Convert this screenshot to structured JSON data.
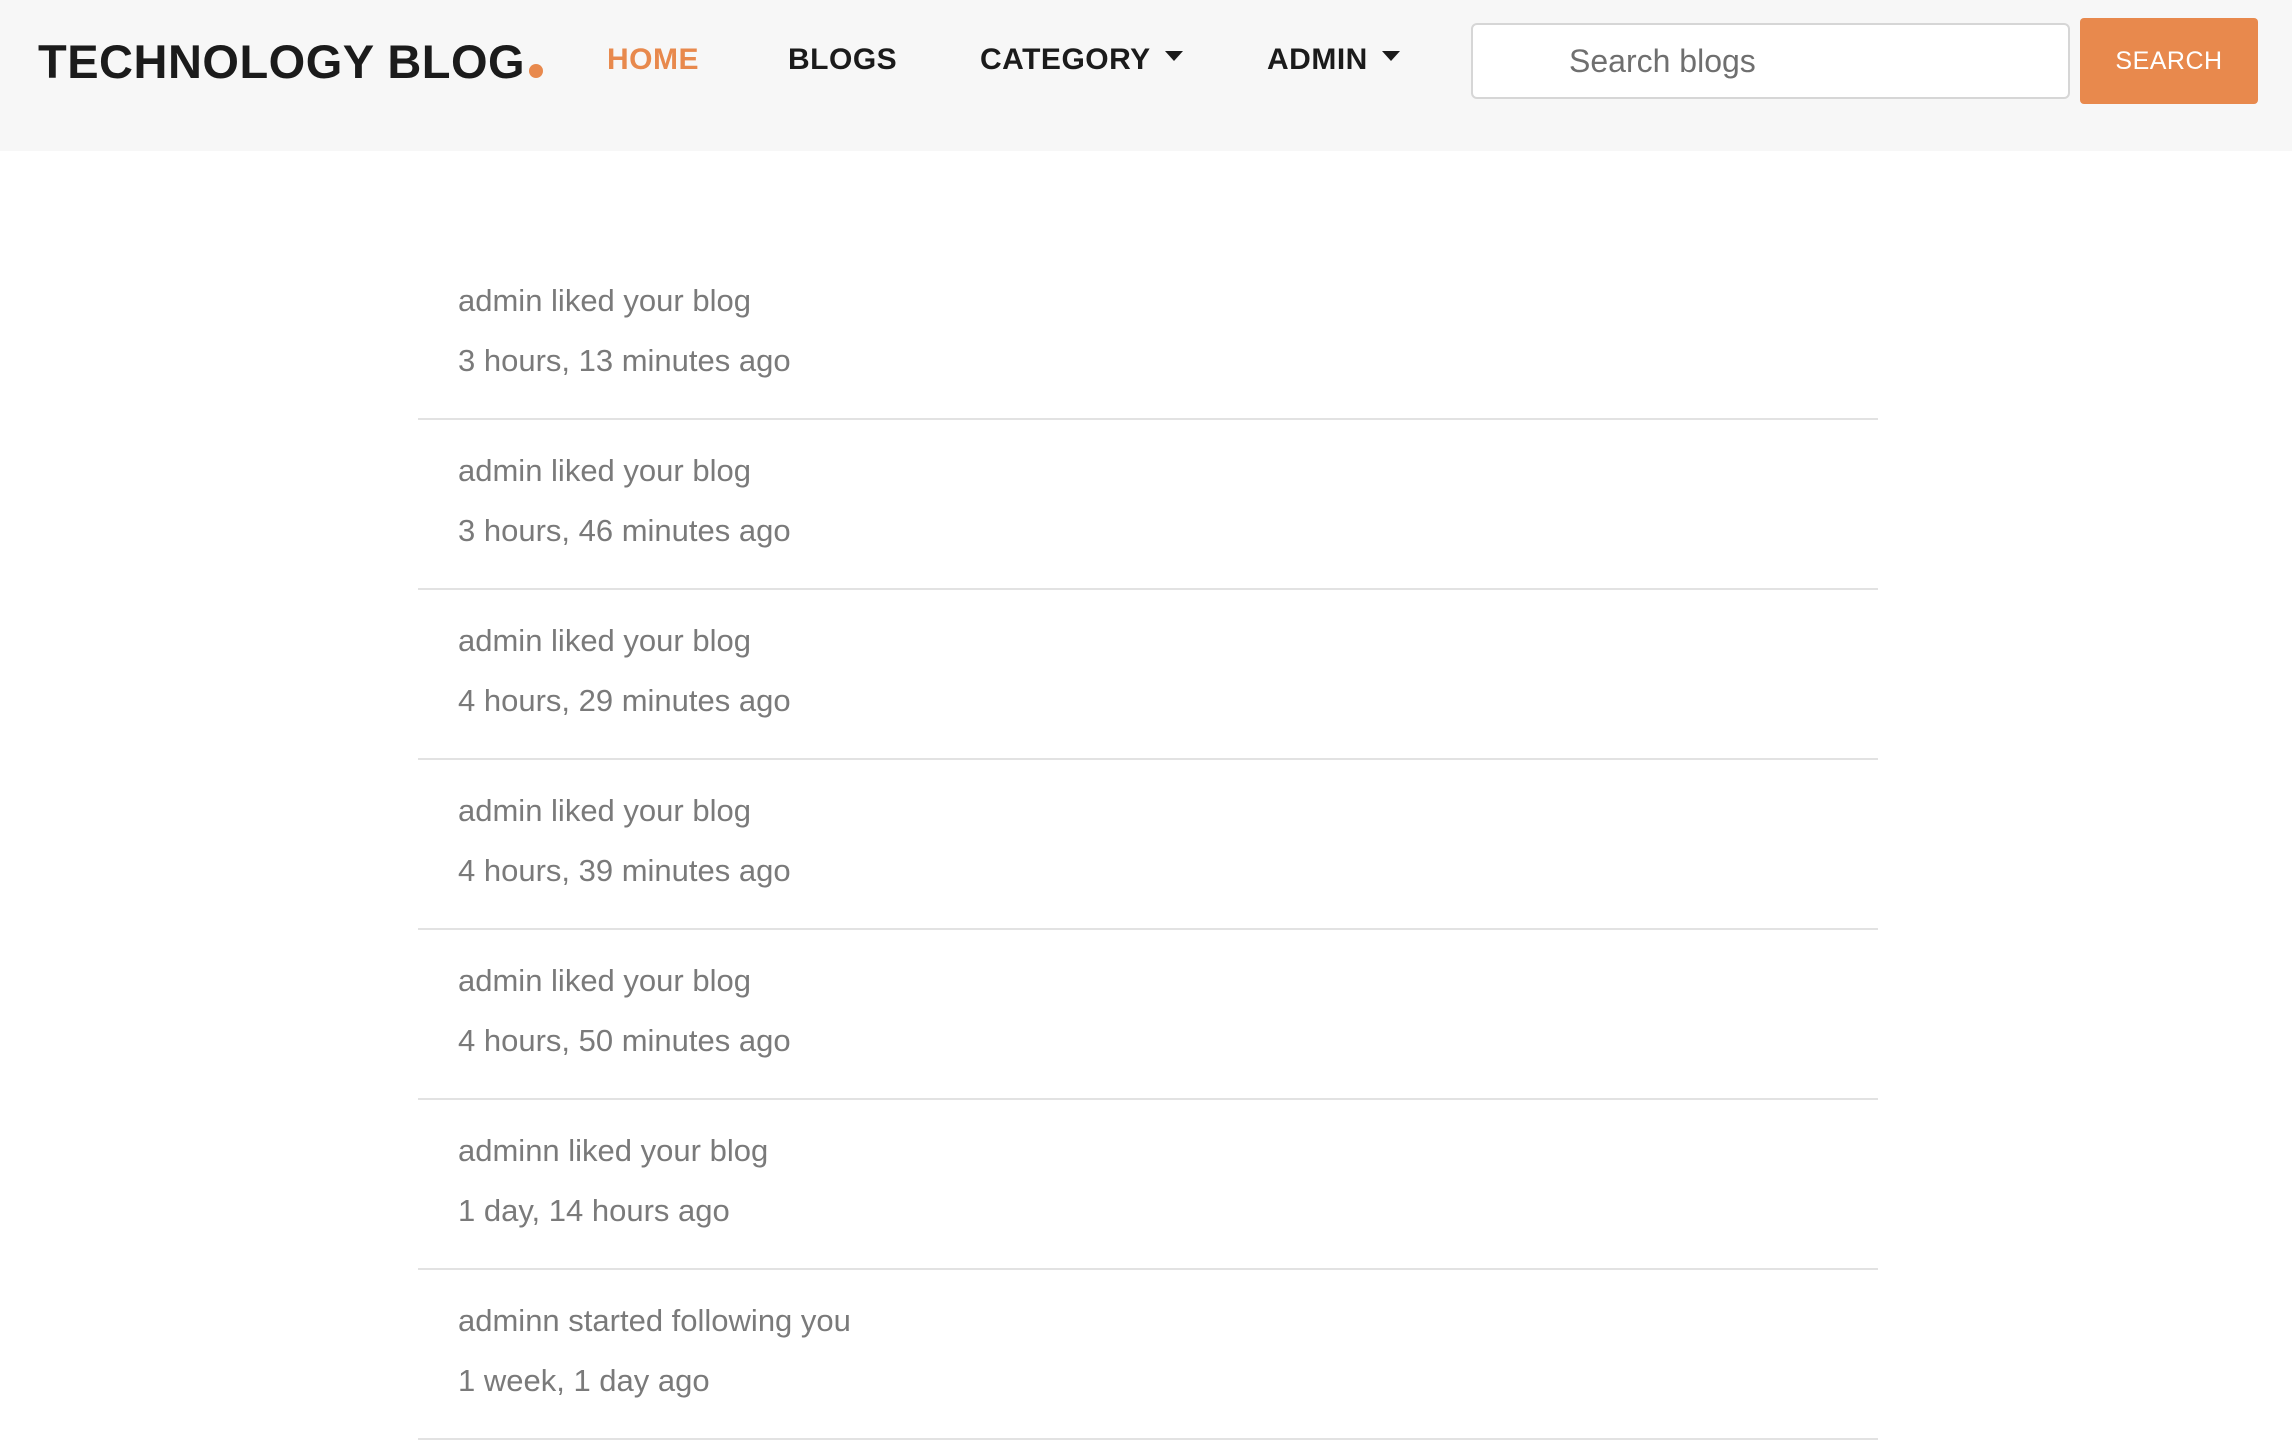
{
  "colors": {
    "accent": "#e8894d",
    "nav_background": "#f7f7f7",
    "text_dark": "#1b1b1b",
    "text_muted": "#7a7a7a",
    "divider": "#e2e2e2"
  },
  "navbar": {
    "brand": "TECHNOLOGY BLOG",
    "links": [
      {
        "label": "HOME",
        "active": true
      },
      {
        "label": "BLOGS",
        "active": false
      },
      {
        "label": "CATEGORY",
        "active": false,
        "dropdown": true
      },
      {
        "label": "ADMIN",
        "active": false,
        "dropdown": true
      }
    ],
    "search": {
      "placeholder": "Search blogs",
      "value": "",
      "button_label": "SEARCH"
    }
  },
  "notifications": [
    {
      "message": "admin liked your blog",
      "time": "3 hours, 13 minutes ago"
    },
    {
      "message": "admin liked your blog",
      "time": "3 hours, 46 minutes ago"
    },
    {
      "message": "admin liked your blog",
      "time": "4 hours, 29 minutes ago"
    },
    {
      "message": "admin liked your blog",
      "time": "4 hours, 39 minutes ago"
    },
    {
      "message": "admin liked your blog",
      "time": "4 hours, 50 minutes ago"
    },
    {
      "message": "adminn liked your blog",
      "time": "1 day, 14 hours ago"
    },
    {
      "message": "adminn started following you",
      "time": "1 week, 1 day ago"
    }
  ]
}
